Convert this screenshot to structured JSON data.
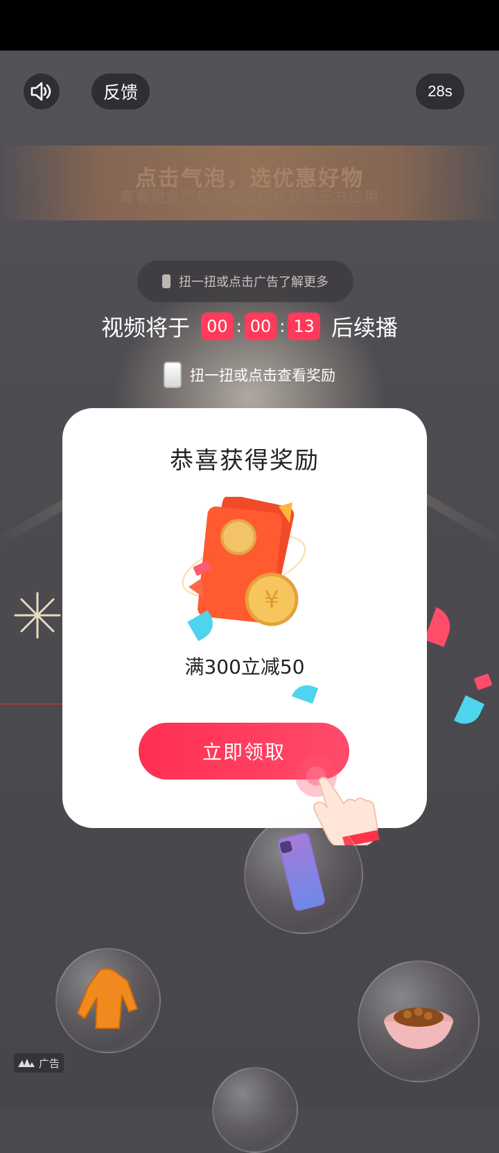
{
  "header": {
    "feedback_label": "反馈",
    "timer_label": "28s"
  },
  "banner": {
    "title": "点击气泡，选优惠好物",
    "subtitle": "查看更多广告详情或跳转到第三方应用"
  },
  "shake_hint": "扭一扭或点击广告了解更多",
  "countdown": {
    "prefix": "视频将于",
    "hours": "00",
    "minutes": "00",
    "seconds": "13",
    "suffix": "后续播"
  },
  "reward_hint": "扭一扭或点击查看奖励",
  "modal": {
    "title": "恭喜获得奖励",
    "coupon": "满300立减50",
    "claim_label": "立即领取"
  },
  "ad_badge": "广告",
  "colors": {
    "accent": "#ff3a5a",
    "modal_bg": "#ffffff",
    "backdrop": "#4a4a4f"
  },
  "icons": [
    "speaker-icon",
    "shake-phone-icon",
    "red-envelope-icon",
    "hand-pointer-icon",
    "ad-logo-icon"
  ]
}
